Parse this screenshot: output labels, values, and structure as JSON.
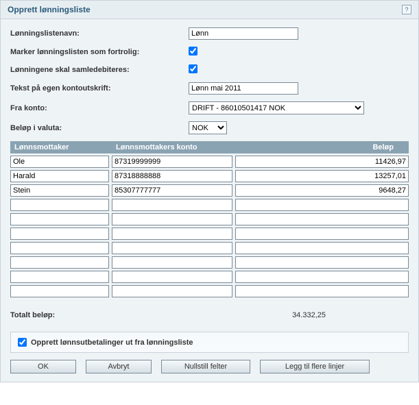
{
  "header": {
    "title": "Opprett lønningsliste",
    "help_icon": "?"
  },
  "form": {
    "labels": {
      "list_name": "Lønningslistenavn:",
      "confidential": "Marker lønningslisten som fortrolig:",
      "collective_debit": "Lønningene skal samledebiteres:",
      "statement_text": "Tekst på egen kontoutskrift:",
      "from_account": "Fra konto:",
      "currency": "Beløp i valuta:"
    },
    "values": {
      "list_name": "Lønn",
      "confidential": true,
      "collective_debit": true,
      "statement_text": "Lønn mai 2011",
      "from_account": "DRIFT - 86010501417 NOK",
      "currency": "NOK"
    }
  },
  "grid": {
    "headers": {
      "recipient": "Lønnsmottaker",
      "account": "Lønnsmottakers konto",
      "amount": "Beløp"
    },
    "rows": [
      {
        "name": "Ole",
        "account": "87319999999",
        "amount": "11426,97"
      },
      {
        "name": "Harald",
        "account": "87318888888",
        "amount": "13257,01"
      },
      {
        "name": "Stein",
        "account": "85307777777",
        "amount": "9648,27"
      },
      {
        "name": "",
        "account": "",
        "amount": ""
      },
      {
        "name": "",
        "account": "",
        "amount": ""
      },
      {
        "name": "",
        "account": "",
        "amount": ""
      },
      {
        "name": "",
        "account": "",
        "amount": ""
      },
      {
        "name": "",
        "account": "",
        "amount": ""
      },
      {
        "name": "",
        "account": "",
        "amount": ""
      },
      {
        "name": "",
        "account": "",
        "amount": ""
      }
    ]
  },
  "total": {
    "label": "Totalt beløp:",
    "value": "34.332,25"
  },
  "opt": {
    "create_payments": true,
    "create_payments_label": "Opprett lønnsutbetalinger ut fra lønningsliste"
  },
  "buttons": {
    "ok": "OK",
    "cancel": "Avbryt",
    "reset": "Nullstill felter",
    "add_lines": "Legg til flere linjer"
  }
}
